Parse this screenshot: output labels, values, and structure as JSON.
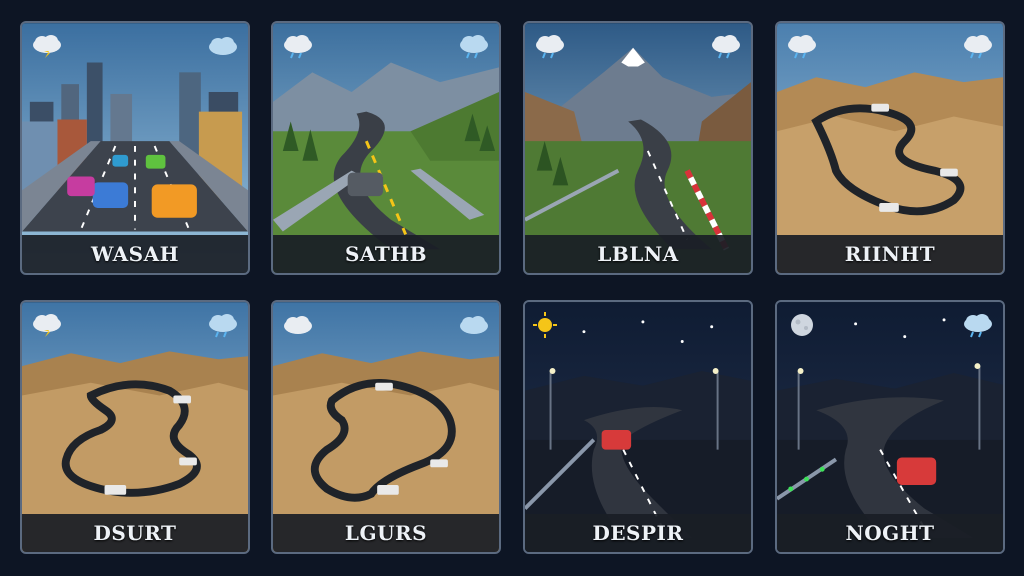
{
  "screen": {
    "title": ""
  },
  "tracks": [
    {
      "name": "WASAH",
      "scene": "city",
      "weather_left": "storm-cloud-icon",
      "weather_right": "cloud-icon"
    },
    {
      "name": "SATHB",
      "scene": "hills",
      "weather_left": "rain-cloud-icon",
      "weather_right": "rain-cloud-icon"
    },
    {
      "name": "LBLNA",
      "scene": "mountain",
      "weather_left": "rain-cloud-icon",
      "weather_right": "rain-cloud-icon"
    },
    {
      "name": "RIINHT",
      "scene": "desert-top",
      "weather_left": "rain-cloud-icon",
      "weather_right": "rain-cloud-icon"
    },
    {
      "name": "DSURT",
      "scene": "desert",
      "weather_left": "storm-cloud-icon",
      "weather_right": "rain-cloud-icon"
    },
    {
      "name": "LGURS",
      "scene": "desert",
      "weather_left": "cloud-icon",
      "weather_right": "cloud-icon"
    },
    {
      "name": "DESPIR",
      "scene": "night",
      "weather_left": "sun-moon-icon",
      "weather_right": "moon-icon"
    },
    {
      "name": "NOGHT",
      "scene": "night2",
      "weather_left": "full-moon-icon",
      "weather_right": "rain-cloud-icon"
    }
  ],
  "colors": {
    "background": "#0d1524",
    "card_border": "#5b6a80",
    "label_text": "#eef2f7",
    "label_bar": "#1a1e26"
  }
}
